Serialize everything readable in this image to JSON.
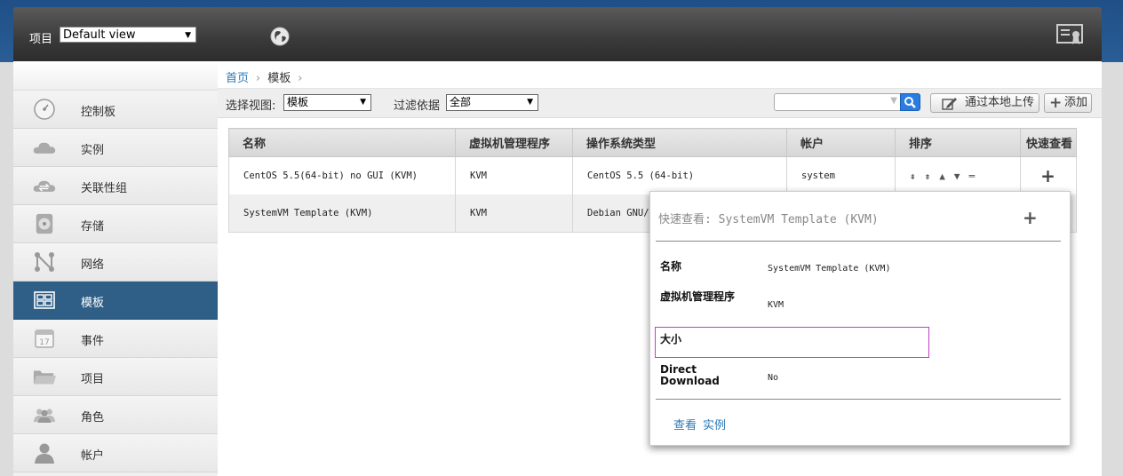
{
  "header": {
    "project_label": "项目",
    "project_value": "Default view"
  },
  "sidebar": {
    "items": [
      {
        "label": "控制板",
        "icon": "dashboard-icon"
      },
      {
        "label": "实例",
        "icon": "cloud-icon"
      },
      {
        "label": "关联性组",
        "icon": "affinity-cloud-icon"
      },
      {
        "label": "存储",
        "icon": "storage-disk-icon"
      },
      {
        "label": "网络",
        "icon": "network-icon"
      },
      {
        "label": "模板",
        "icon": "template-icon",
        "active": true
      },
      {
        "label": "事件",
        "icon": "calendar-icon"
      },
      {
        "label": "项目",
        "icon": "folder-icon"
      },
      {
        "label": "角色",
        "icon": "roles-icon"
      },
      {
        "label": "帐户",
        "icon": "user-icon"
      }
    ]
  },
  "breadcrumb": {
    "home": "首页",
    "current": "模板"
  },
  "toolbar": {
    "view_label": "选择视图:",
    "view_value": "模板",
    "filter_label": "过滤依据",
    "filter_value": "全部",
    "upload_label": "通过本地上传",
    "add_label": "添加"
  },
  "table": {
    "columns": [
      "名称",
      "虚拟机管理程序",
      "操作系统类型",
      "帐户",
      "排序",
      "快速查看"
    ],
    "rows": [
      {
        "name": "CentOS 5.5(64-bit) no GUI (KVM)",
        "hypervisor": "KVM",
        "os": "CentOS 5.5 (64-bit)",
        "account": "system"
      },
      {
        "name": "SystemVM Template (KVM)",
        "hypervisor": "KVM",
        "os": "Debian GNU/L",
        "account": ""
      }
    ]
  },
  "quickview": {
    "title": "快速查看: SystemVM Template (KVM)",
    "fields": [
      {
        "label": "名称",
        "value": "SystemVM Template (KVM)"
      },
      {
        "label": "虚拟机管理程序",
        "value": "KVM"
      },
      {
        "label": "大小",
        "value": ""
      },
      {
        "label": "Direct Download",
        "value": "No"
      }
    ],
    "actions": [
      "查看",
      "实例"
    ]
  },
  "colors": {
    "accent": "#2f5f86",
    "link": "#2b79b5",
    "highlight": "#c33fc3"
  }
}
